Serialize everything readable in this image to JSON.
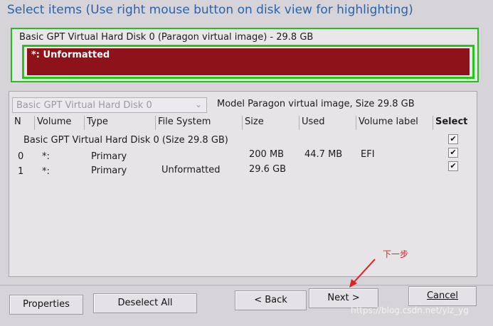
{
  "title": "Select items (Use right mouse button on disk view for highlighting)",
  "disk_view": {
    "label": "Basic GPT Virtual Hard Disk 0 (Paragon virtual image) - 29.8 GB",
    "partition_label": "*: Unformatted"
  },
  "disk_select": {
    "value": "Basic GPT Virtual Hard Disk 0",
    "model_info": "Model Paragon virtual image, Size 29.8 GB"
  },
  "table": {
    "columns": [
      "N",
      "Volume",
      "Type",
      "File System",
      "Size",
      "Used",
      "Volume label",
      "Select"
    ],
    "group": "Basic GPT Virtual Hard Disk 0 (Size 29.8 GB)",
    "rows": [
      {
        "n": "0",
        "volume": "*:",
        "type": "Primary",
        "fs": "",
        "size": "200 MB",
        "used": "44.7 MB",
        "label": "EFI",
        "select": "✔"
      },
      {
        "n": "1",
        "volume": "*:",
        "type": "Primary",
        "fs": "Unformatted",
        "size": "29.6 GB",
        "used": "",
        "label": "",
        "select": "✔"
      }
    ],
    "group_select": "✔"
  },
  "buttons": {
    "properties": "Properties",
    "deselect_all": "Deselect All",
    "back": "< Back",
    "next": "Next >",
    "cancel": "Cancel"
  },
  "annotation": "下一步",
  "watermark": "https://blog.csdn.net/ylz_yg",
  "colors": {
    "highlight_green": "#23c01b",
    "partition_red": "#8e1219",
    "title_blue": "#2a63a8",
    "annotation_red": "#e02020"
  }
}
